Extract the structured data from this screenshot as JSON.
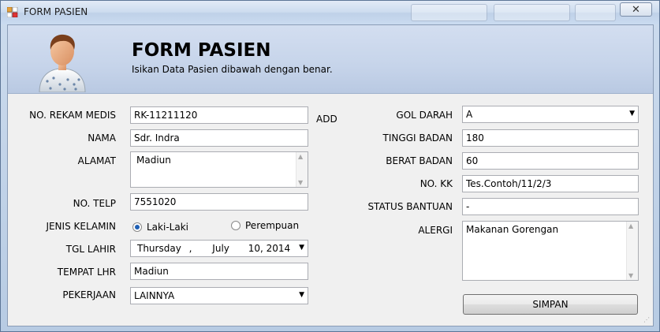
{
  "window": {
    "title": "FORM PASIEN",
    "close_glyph": "✕"
  },
  "header": {
    "title": "FORM PASIEN",
    "subtitle": "Isikan Data Pasien dibawah dengan benar."
  },
  "left": {
    "rekam_medis": {
      "label": "NO. REKAM MEDIS",
      "value": "RK-11211120",
      "add_label": "ADD"
    },
    "nama": {
      "label": "NAMA",
      "value": "Sdr. Indra"
    },
    "alamat": {
      "label": "ALAMAT",
      "value": "Madiun"
    },
    "telp": {
      "label": "NO. TELP",
      "value": "7551020"
    },
    "jenis_kelamin": {
      "label": "JENIS KELAMIN",
      "option_male": "Laki-Laki",
      "option_female": "Perempuan",
      "selected": "Laki-Laki"
    },
    "tgl_lahir": {
      "label": "TGL LAHIR",
      "day": "Thursday",
      "sep1": ",",
      "month": "July",
      "date": "10, 2014"
    },
    "tempat_lhr": {
      "label": "TEMPAT LHR",
      "value": "Madiun"
    },
    "pekerjaan": {
      "label": "PEKERJAAN",
      "value": "LAINNYA"
    }
  },
  "right": {
    "gol_darah": {
      "label": "GOL DARAH",
      "value": "A"
    },
    "tinggi_badan": {
      "label": "TINGGI BADAN",
      "value": "180"
    },
    "berat_badan": {
      "label": "BERAT BADAN",
      "value": "60"
    },
    "no_kk": {
      "label": "NO. KK",
      "value": "Tes.Contoh/11/2/3"
    },
    "status_bantuan": {
      "label": "STATUS BANTUAN",
      "value": "-"
    },
    "alergi": {
      "label": "ALERGI",
      "value": "Makanan Gorengan"
    }
  },
  "actions": {
    "save_label": "SIMPAN"
  },
  "colors": {
    "accent": "#1e5fb4",
    "header_bg": "#c6d4ea",
    "form_bg": "#f0f0f0"
  }
}
